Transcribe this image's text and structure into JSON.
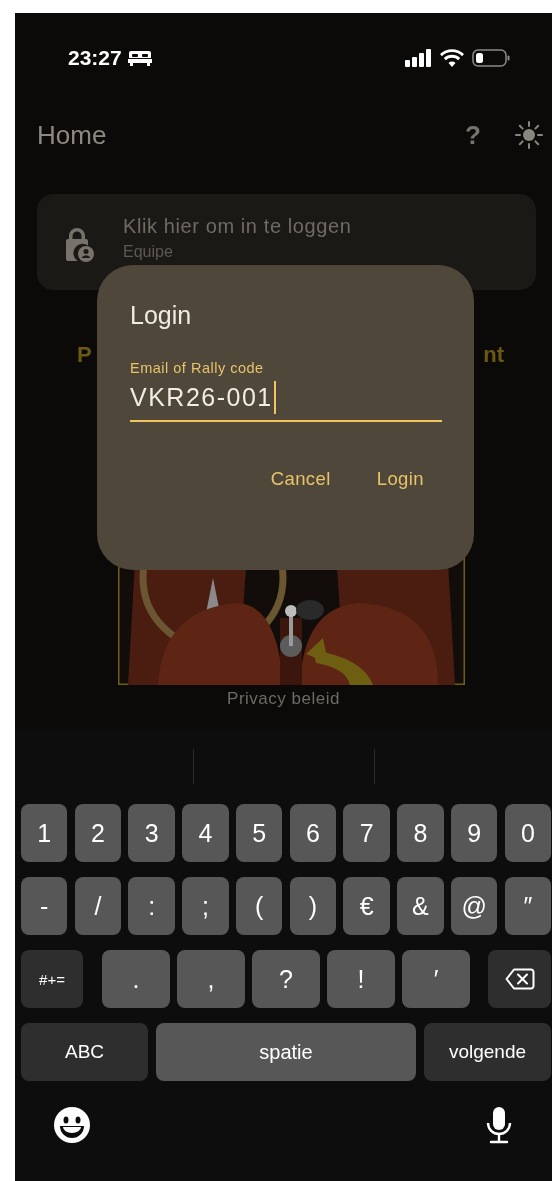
{
  "status_bar": {
    "time": "23:27"
  },
  "header": {
    "title": "Home",
    "help": "?"
  },
  "login_card": {
    "title": "Klik hier om in te loggen",
    "subtitle": "Equipe"
  },
  "heading_fragments": [
    "P",
    "nt"
  ],
  "footer_link": "Privacy beleid",
  "dialog": {
    "title": "Login",
    "field": {
      "label": "Email of Rally code",
      "value": "VKR26-001"
    },
    "buttons": [
      "Cancel",
      "Login"
    ]
  },
  "keyboard": {
    "number_row": [
      {
        "kind": "char",
        "label": "1"
      },
      {
        "kind": "char",
        "label": "2"
      },
      {
        "kind": "char",
        "label": "3"
      },
      {
        "kind": "char",
        "label": "4"
      },
      {
        "kind": "char",
        "label": "5"
      },
      {
        "kind": "char",
        "label": "6"
      },
      {
        "kind": "char",
        "label": "7"
      },
      {
        "kind": "char",
        "label": "8"
      },
      {
        "kind": "char",
        "label": "9"
      },
      {
        "kind": "char",
        "label": "0"
      }
    ],
    "symbol_row": [
      {
        "kind": "char",
        "label": "-"
      },
      {
        "kind": "char",
        "label": "/"
      },
      {
        "kind": "char",
        "label": ":"
      },
      {
        "kind": "char",
        "label": ";"
      },
      {
        "kind": "char",
        "label": "("
      },
      {
        "kind": "char",
        "label": ")"
      },
      {
        "kind": "char",
        "label": "€"
      },
      {
        "kind": "char",
        "label": "&"
      },
      {
        "kind": "char",
        "label": "@"
      },
      {
        "kind": "char",
        "label": "″"
      }
    ],
    "punctuation_row": [
      {
        "kind": "function",
        "label": "#+="
      },
      {
        "kind": "char",
        "label": "."
      },
      {
        "kind": "char",
        "label": ","
      },
      {
        "kind": "char",
        "label": "?"
      },
      {
        "kind": "char",
        "label": "!"
      },
      {
        "kind": "char",
        "label": "′"
      },
      {
        "kind": "delete"
      }
    ],
    "bottom_row": [
      {
        "kind": "function",
        "label": "ABC"
      },
      {
        "kind": "space",
        "label": "spatie"
      },
      {
        "kind": "function",
        "label": "volgende"
      }
    ]
  }
}
